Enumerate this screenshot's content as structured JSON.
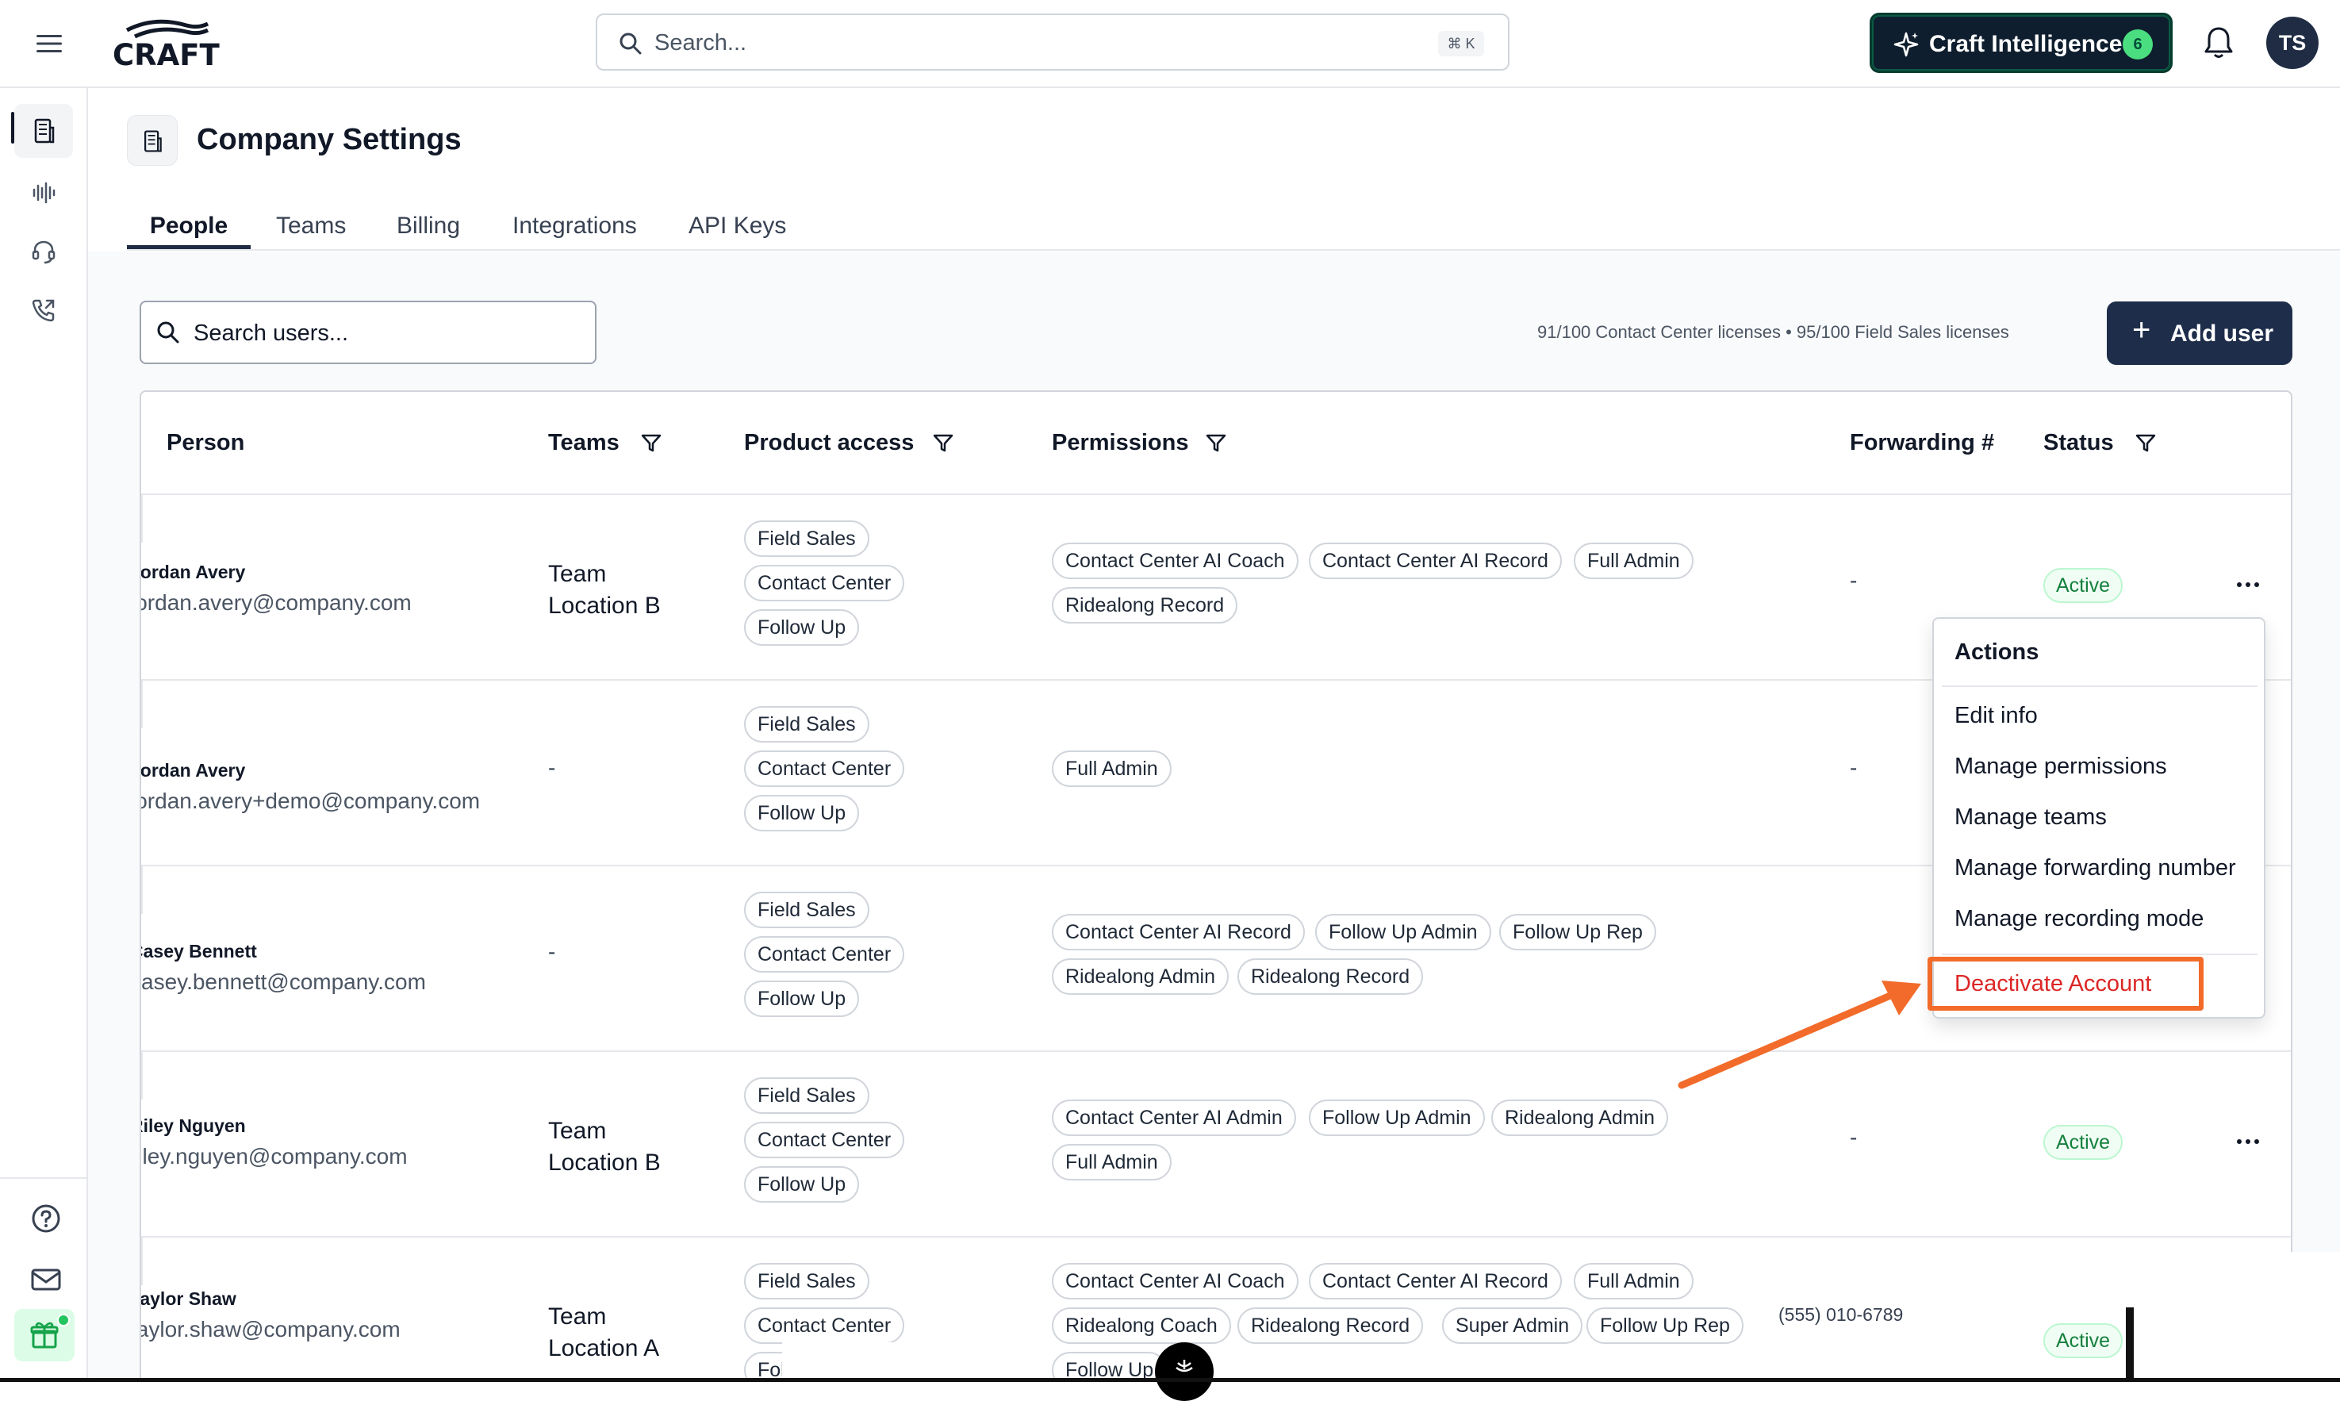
{
  "app": {
    "logo_text": "CRAFT",
    "search_placeholder": "Search...",
    "search_shortcut": "⌘ K",
    "ci_label": "Craft Intelligence",
    "ci_count": "6",
    "avatar_initials": "TS"
  },
  "page": {
    "title": "Company Settings",
    "tabs": [
      "People",
      "Teams",
      "Billing",
      "Integrations",
      "API Keys"
    ],
    "active_tab": "People"
  },
  "toolbar": {
    "search_placeholder": "Search users...",
    "licenses_text": "91/100 Contact Center licenses  •  95/100 Field Sales licenses",
    "add_user_label": "Add user",
    "add_user_icon": "+"
  },
  "table": {
    "headers": {
      "person": "Person",
      "teams": "Teams",
      "product_access": "Product access",
      "permissions": "Permissions",
      "forwarding": "Forwarding #",
      "status": "Status"
    },
    "rows": [
      {
        "name": "Jordan Avery",
        "email": "jordan.avery@company.com",
        "team": "Team Location B",
        "products": [
          "Field Sales",
          "Contact Center",
          "Follow Up"
        ],
        "permissions": [
          "Contact Center AI Coach",
          "Contact Center AI Record",
          "Full Admin",
          "Ridealong Record"
        ],
        "forwarding": "-",
        "status": "Active"
      },
      {
        "name": "Jordan Avery",
        "email": "jordan.avery+demo@company.com",
        "team": "-",
        "products": [
          "Field Sales",
          "Contact Center",
          "Follow Up"
        ],
        "permissions": [
          "Full Admin"
        ],
        "forwarding": "-",
        "status": ""
      },
      {
        "name": "Casey Bennett",
        "email": "casey.bennett@company.com",
        "team": "-",
        "products": [
          "Field Sales",
          "Contact Center",
          "Follow Up"
        ],
        "permissions": [
          "Contact Center AI Record",
          "Follow Up Admin",
          "Follow Up Rep",
          "Ridealong Admin",
          "Ridealong Record"
        ],
        "forwarding": "",
        "status": ""
      },
      {
        "name": "Riley Nguyen",
        "email": "riley.nguyen@company.com",
        "team": "Team Location B",
        "products": [
          "Field Sales",
          "Contact Center",
          "Follow Up"
        ],
        "permissions": [
          "Contact Center AI Admin",
          "Follow Up Admin",
          "Ridealong Admin",
          "Full Admin"
        ],
        "forwarding": "-",
        "status": "Active"
      },
      {
        "name": "Taylor Shaw",
        "email": "taylor.shaw@company.com",
        "team": "Team Location A",
        "products": [
          "Field Sales",
          "Contact Center",
          "Fol"
        ],
        "permissions": [
          "Contact Center AI Coach",
          "Contact Center AI Record",
          "Full Admin",
          "Ridealong Coach",
          "Ridealong Record",
          "Super Admin",
          "Follow Up Rep",
          "Follow Up"
        ],
        "forwarding": "(555) 010-6789",
        "status": "Active"
      }
    ]
  },
  "actions_menu": {
    "title": "Actions",
    "items": [
      "Edit info",
      "Manage permissions",
      "Manage teams",
      "Manage forwarding number",
      "Manage recording mode"
    ],
    "danger_item": "Deactivate Account"
  },
  "colors": {
    "primary": "#1e2d4a",
    "active_green": "#15803d",
    "danger": "#dc2626",
    "highlight": "#f26b2a"
  },
  "icons": {
    "menu": "hamburger-icon",
    "search": "search-icon",
    "ci": "sparkle-icon",
    "bell": "bell-icon",
    "filter": "filter-icon",
    "more": "more-horizontal-icon"
  }
}
